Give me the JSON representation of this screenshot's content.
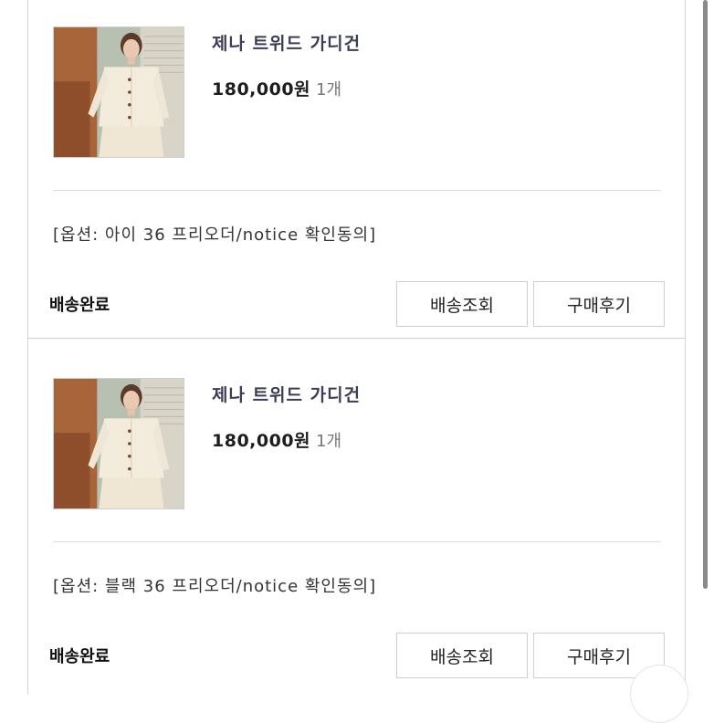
{
  "orders": [
    {
      "product_name": "제나 트위드 가디건",
      "price": "180,000원",
      "quantity": "1개",
      "option": "[옵션: 아이 36 프리오더/notice 확인동의]",
      "status": "배송완료",
      "buttons": {
        "track": "배송조회",
        "review": "구매후기"
      }
    },
    {
      "product_name": "제나 트위드 가디건",
      "price": "180,000원",
      "quantity": "1개",
      "option": "[옵션: 블랙 36 프리오더/notice 확인동의]",
      "status": "배송완료",
      "buttons": {
        "track": "배송조회",
        "review": "구매후기"
      }
    }
  ],
  "colors": {
    "product_name": "#3b3d56",
    "border": "#cfcfcf",
    "cardigan": "#f3ecdd",
    "background_wood": "#a9653a"
  }
}
